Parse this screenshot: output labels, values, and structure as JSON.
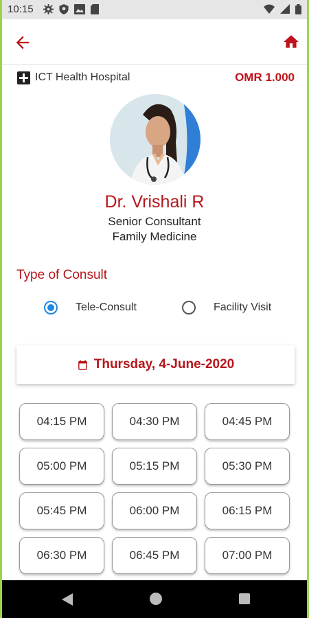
{
  "status_bar": {
    "time": "10:15",
    "left_icons": [
      "gear-icon",
      "shield-icon",
      "image-icon",
      "sd-card-icon"
    ],
    "right_icons": [
      "wifi-icon",
      "signal-icon",
      "battery-icon"
    ]
  },
  "app_bar": {
    "back_icon": "arrow-left-icon",
    "home_icon": "home-icon",
    "accent": "#c0121a"
  },
  "hospital": {
    "icon": "hospital-cross-icon",
    "name": "ICT Health Hospital",
    "price": "OMR 1.000"
  },
  "doctor": {
    "name": "Dr. Vrishali R",
    "designation": "Senior Consultant",
    "specialty": "Family Medicine"
  },
  "consult": {
    "heading": "Type of Consult",
    "options": [
      {
        "label": "Tele-Consult",
        "selected": true
      },
      {
        "label": "Facility Visit",
        "selected": false
      }
    ]
  },
  "date": {
    "icon": "calendar-icon",
    "label": "Thursday, 4-June-2020"
  },
  "slots": [
    "04:15 PM",
    "04:30 PM",
    "04:45 PM",
    "05:00 PM",
    "05:15 PM",
    "05:30 PM",
    "05:45 PM",
    "06:00 PM",
    "06:15 PM",
    "06:30 PM",
    "06:45 PM",
    "07:00 PM"
  ],
  "nav_bar": {
    "icons": [
      "nav-back-icon",
      "nav-home-icon",
      "nav-recents-icon"
    ]
  }
}
